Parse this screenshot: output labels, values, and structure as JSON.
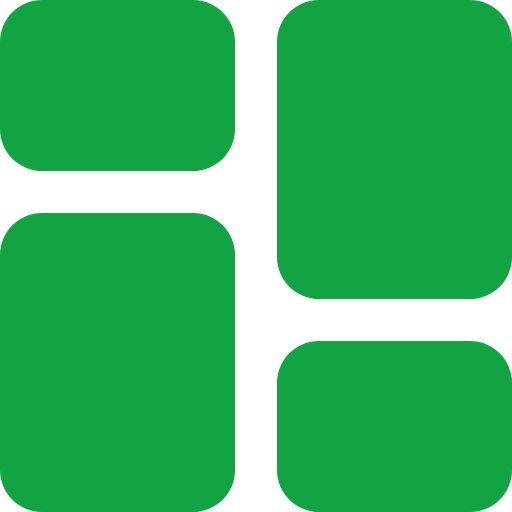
{
  "icon": {
    "name": "dashboard-layout-icon",
    "color": "#12A443",
    "background": "#FFFFFF"
  }
}
